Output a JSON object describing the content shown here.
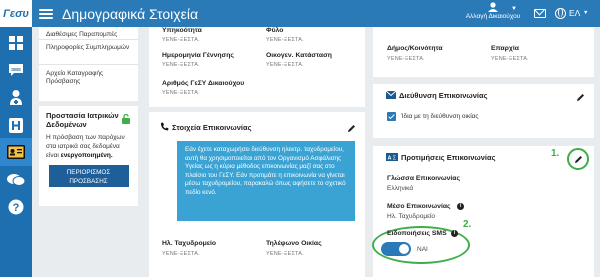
{
  "header": {
    "logo": "Γεσυ",
    "title": "Δημογραφικά Στοιχεία",
    "switch_user": "Αλλαγή Δικαιούχου",
    "language": "ΕΛ"
  },
  "left_menu": {
    "items": [
      "Διαθέσιμες Παραπομπές",
      "Πληροφορίες Συμπληρωμών",
      "Αρχείο Καταγραφής Πρόσβασης"
    ]
  },
  "privacy": {
    "title": "Προστασία Ιατρικών Δεδομένων",
    "text_prefix": "Η πρόσβαση των παρόχων στα ιατρικά σας δεδομένα είναι",
    "text_bold": "ενεργοποιημένη.",
    "button": "ΠΕΡΙΟΡΙΣΜΟΣ ΠΡΟΣΒΑΣΗΣ"
  },
  "personal": {
    "nationality_label": "Υπηκοότητα",
    "gender_label": "Φύλο",
    "birthdate_label": "Ημερομηνία Γέννησης",
    "marital_label": "Οικογεν. Κατάσταση",
    "gesy_label": "Αριθμός ΓεΣΥ Δικαιούχου",
    "redacted": "ΥΕΝΕ-ΞΕΣΤΑ."
  },
  "address": {
    "municipality_label": "Δήμος/Κοινότητα",
    "district_label": "Επαρχία",
    "mail_title": "Διεύθυνση Επικοινωνίας",
    "same_as_home": "Ίδια με τη διεύθυνση οικίας"
  },
  "contact": {
    "title": "Στοιχεία Επικοινωνίας",
    "info": "Εάν έχετε καταχωρήσει διεύθυνση ηλεκτρ. ταχυδρομείου, αυτή θα χρησιμοποιείται από τον Οργανισμό Ασφάλισης Υγείας ως η κύρια μέθοδος επικοινωνίας μαζί σας στο πλαίσιο του ΓεΣΥ. Εάν προτιμάτε η επικοινωνία να γίνεται μέσω ταχυδρομείου, παρακαλώ όπως αφήσετε το σχετικό πεδίο κενό.",
    "email_label": "Ηλ. Ταχυδρομείο",
    "phone_label": "Τηλέφωνο Οικίας"
  },
  "preferences": {
    "title": "Προτιμήσεις Επικοινωνίας",
    "language_label": "Γλώσσα Επικοινωνίας",
    "language_value": "Ελληνικά",
    "method_label": "Μέσο Επικοινωνίας",
    "method_value": "Ηλ. Ταχυδρομείο",
    "sms_label": "Ειδοποιήσεις SMS",
    "sms_value": "ΝΑΙ"
  },
  "annotations": {
    "one": "1.",
    "two": "2."
  },
  "colors": {
    "header": "#2a7ab8",
    "sidebar": "#1d6fb0",
    "info_box": "#3aa3d4",
    "annotation": "#3dae49"
  }
}
